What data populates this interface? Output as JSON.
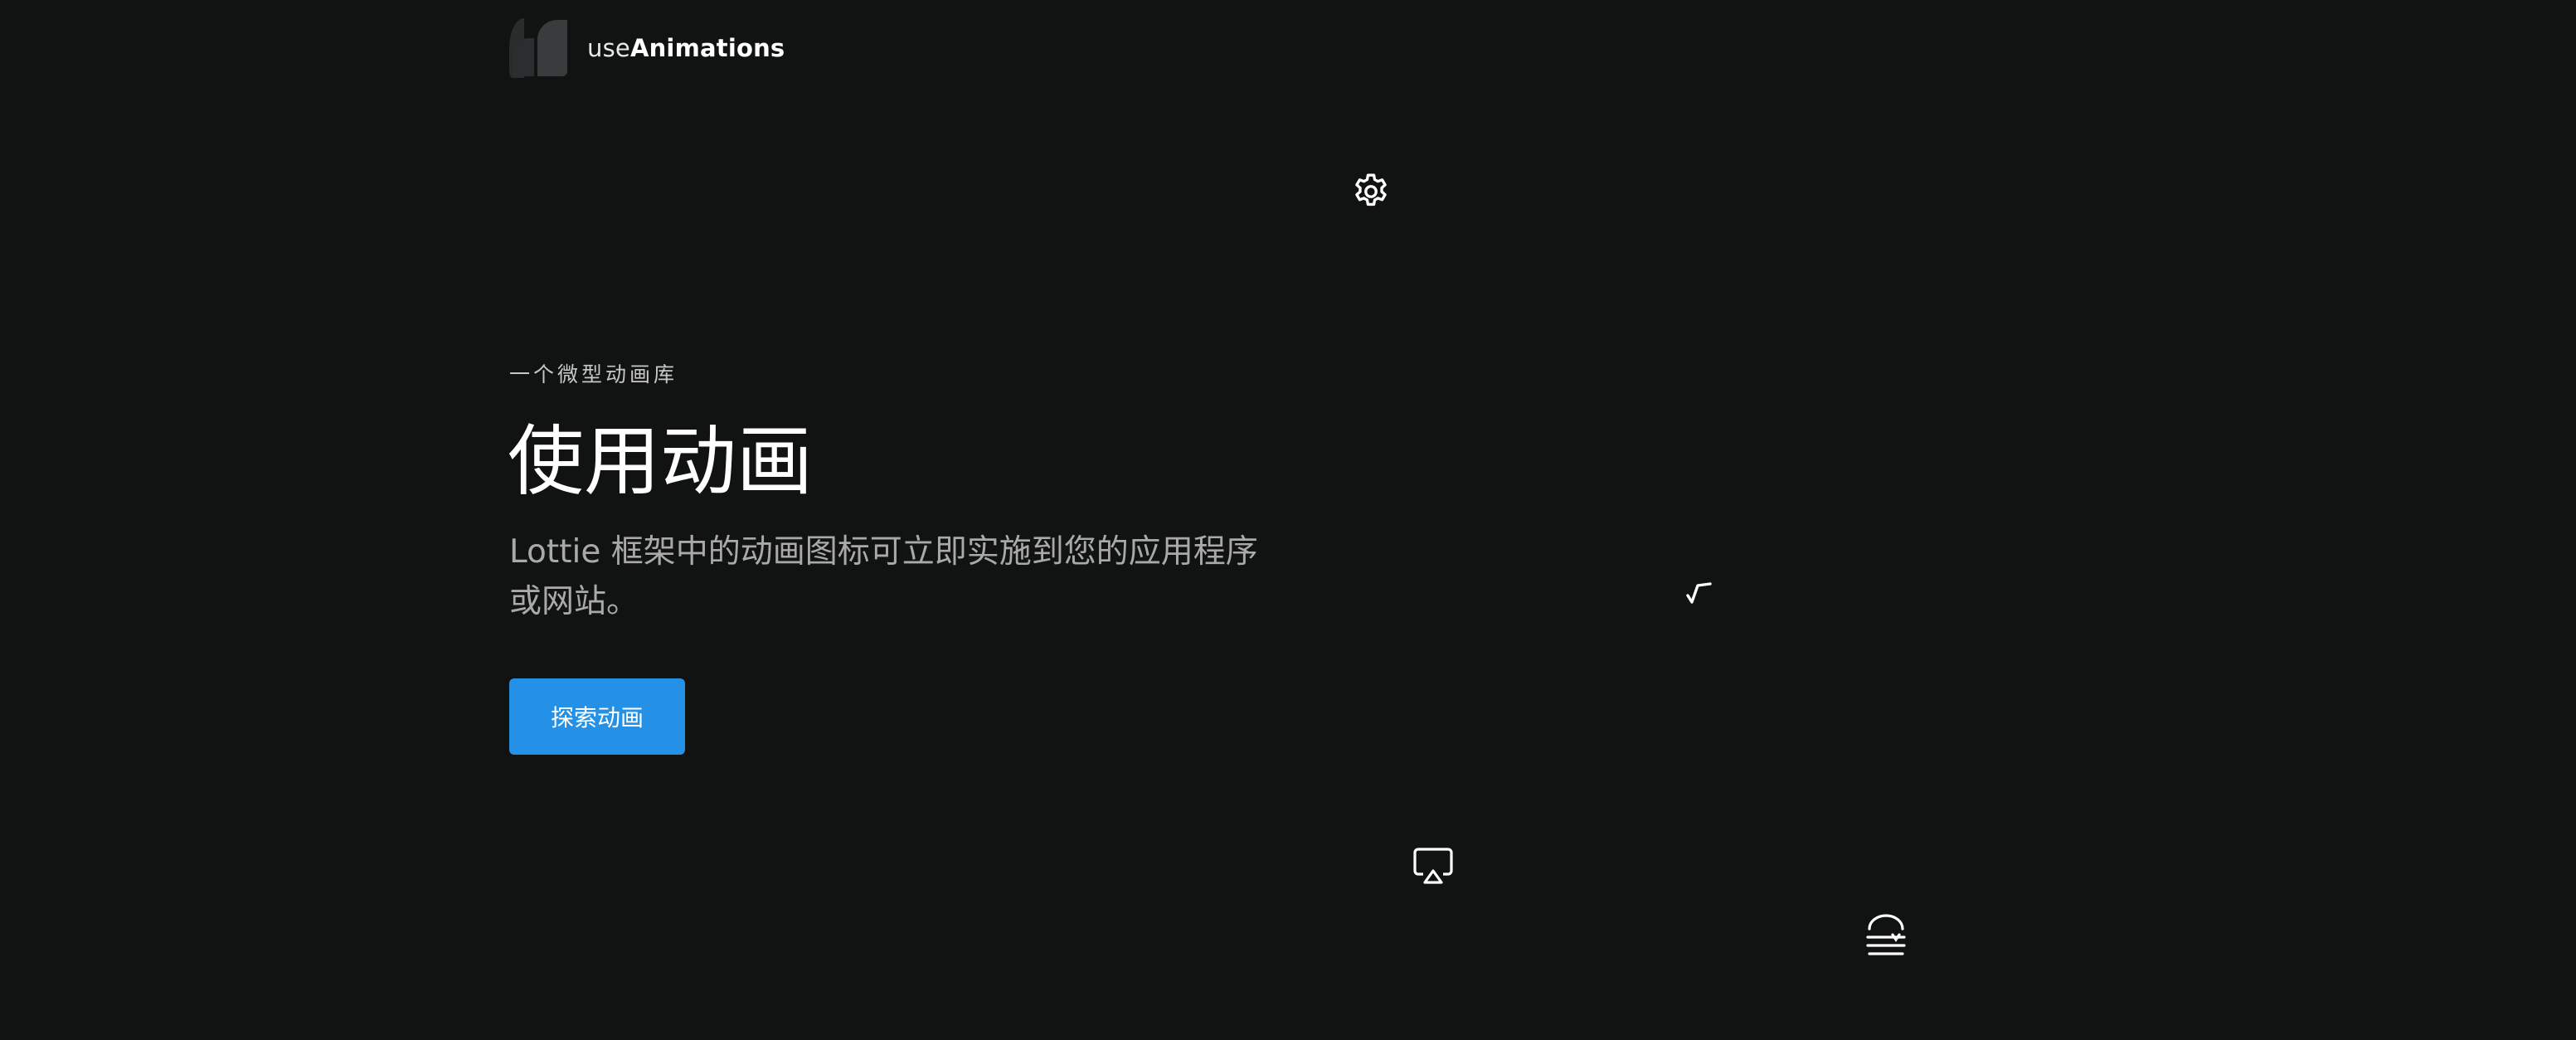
{
  "header": {
    "brand_light": "use",
    "brand_bold": "Animations",
    "logo_icon": "logo-mark-icon"
  },
  "hero": {
    "eyebrow": "一个微型动画库",
    "title": "使用动画",
    "subtitle": "Lottie 框架中的动画图标可立即实施到您的应用程序或网站。",
    "cta_label": "探索动画"
  },
  "floating_icons": [
    "gear-icon",
    "checkmark-icon",
    "airplay-icon",
    "menu-icon"
  ],
  "colors": {
    "background": "#111313",
    "accent": "#2491e6",
    "subtitle": "#a9a9a9",
    "logo_mark": "#3a3b3c"
  }
}
